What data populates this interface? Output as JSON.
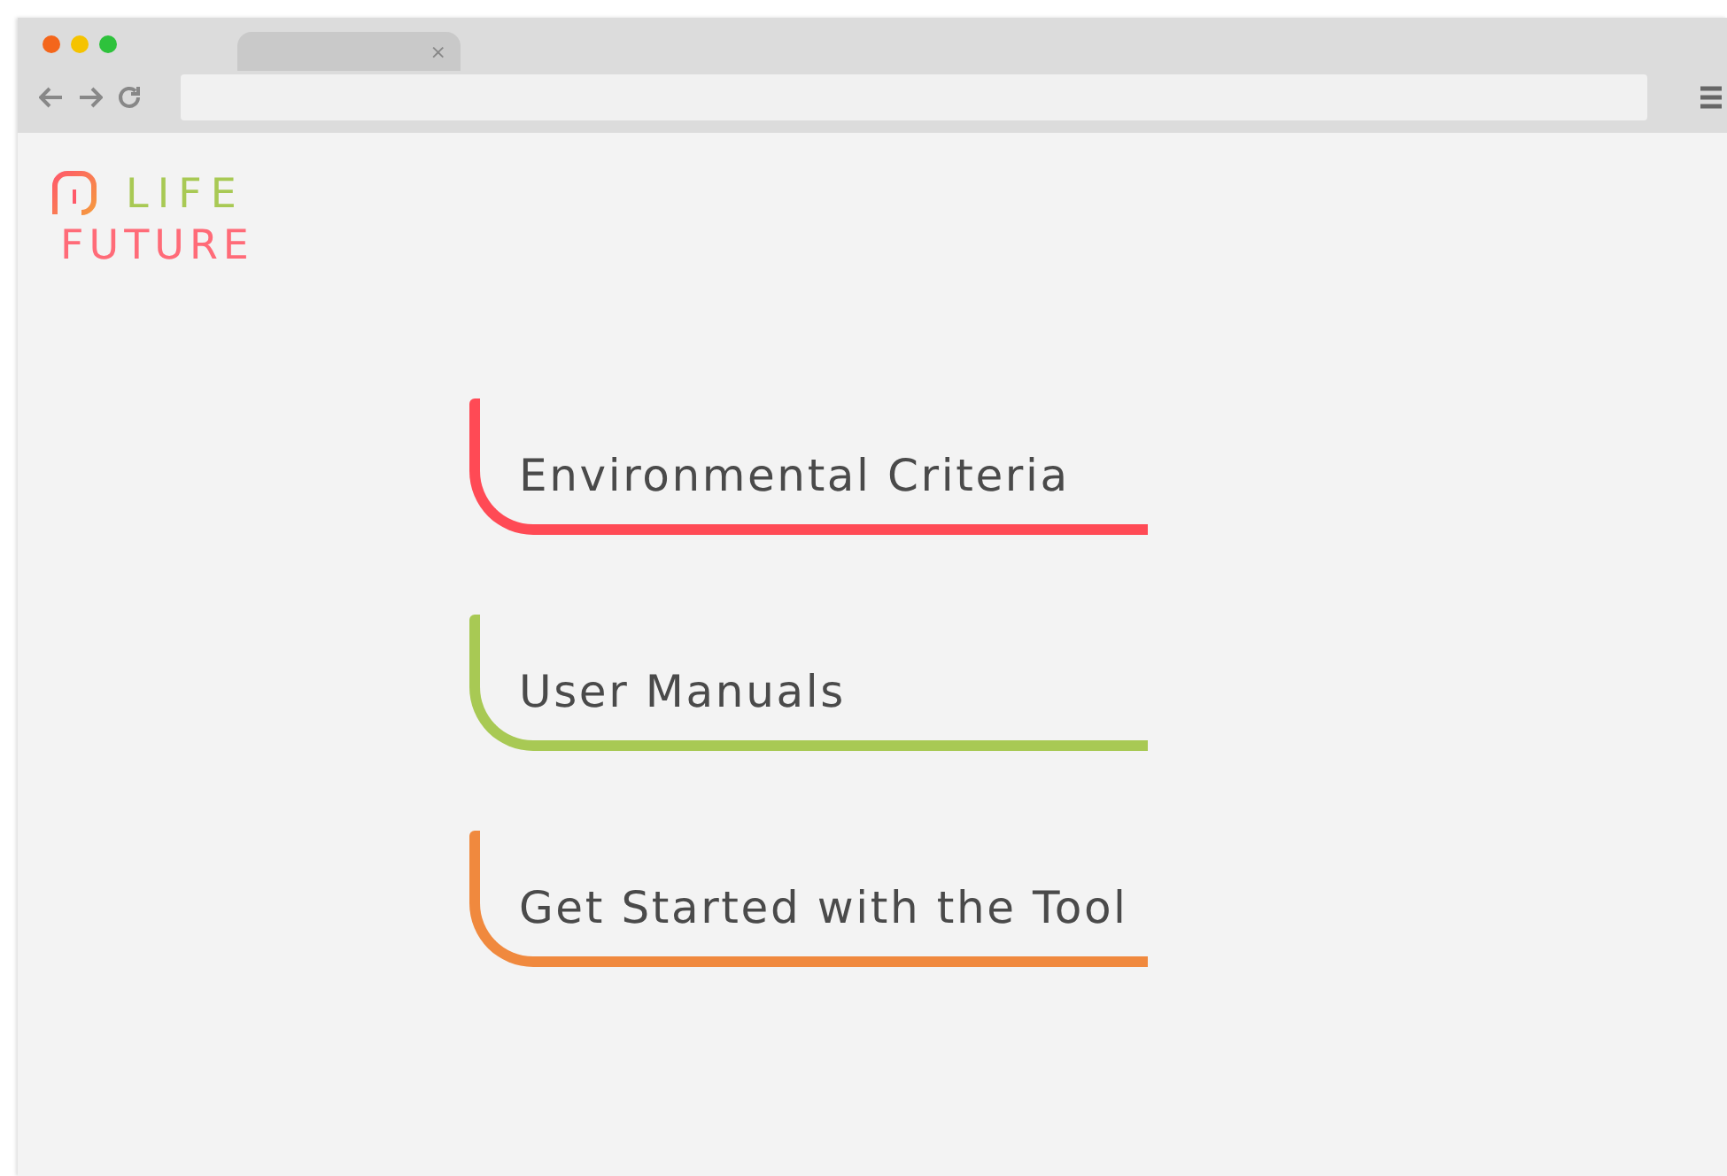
{
  "browser": {
    "tab_close": "×"
  },
  "logo": {
    "top": "LIFE",
    "bottom": "FUTURE"
  },
  "menu": [
    {
      "label": "Environmental Criteria",
      "color": "#ff4a55"
    },
    {
      "label": "User Manuals",
      "color": "#a8c954"
    },
    {
      "label": "Get Started with the Tool",
      "color": "#f0893e"
    }
  ]
}
